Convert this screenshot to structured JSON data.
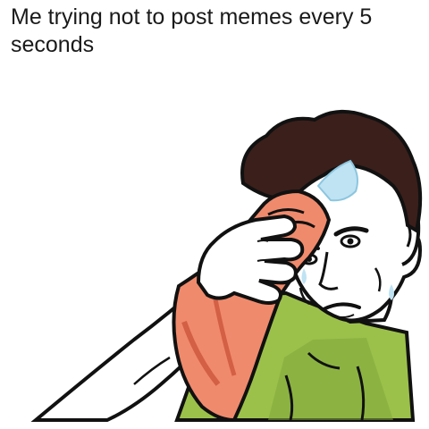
{
  "meme": {
    "caption": "Me trying not to post memes every 5 seconds"
  },
  "colors": {
    "background": "#ffffff",
    "text": "#1a1a1a",
    "hair": "#3b1f1b",
    "skin": "#ffffff",
    "shirt": "#9cc14a",
    "shirt_shadow": "#6f9a2c",
    "towel": "#f08a6c",
    "towel_shadow": "#d35f44",
    "sweat": "#bfe3f3",
    "outline": "#111111"
  },
  "icons": {
    "man": "man-wiping-sweat-icon",
    "towel": "towel-icon"
  }
}
